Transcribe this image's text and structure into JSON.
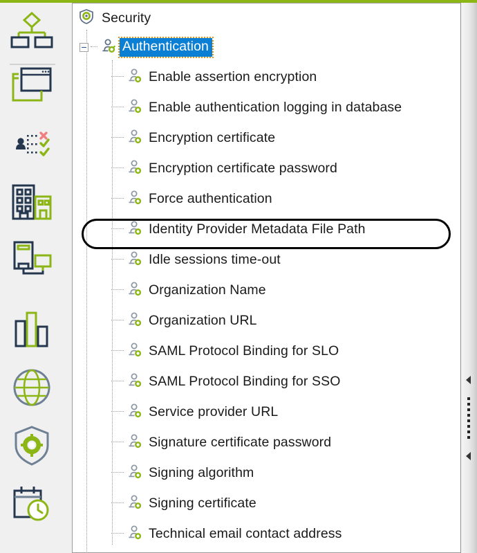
{
  "theme": {
    "accent_green": "#8cb516",
    "dark_navy": "#25374f",
    "selection_blue": "#0a7fd4",
    "focus_orange": "#e8921c",
    "panel_border": "#9a9a9a"
  },
  "sidebar": {
    "items": [
      {
        "icon": "org-chart-icon",
        "name": "sidebar-item-org-chart"
      },
      {
        "icon": "window-layout-icon",
        "name": "sidebar-item-window-layout"
      },
      {
        "icon": "user-provisioning-icon",
        "name": "sidebar-item-user-provisioning"
      },
      {
        "icon": "buildings-icon",
        "name": "sidebar-item-buildings"
      },
      {
        "icon": "devices-icon",
        "name": "sidebar-item-devices"
      },
      {
        "icon": "bar-chart-icon",
        "name": "sidebar-item-bar-chart"
      },
      {
        "icon": "globe-icon",
        "name": "sidebar-item-globe"
      },
      {
        "icon": "shield-gear-icon",
        "name": "sidebar-item-security"
      },
      {
        "icon": "calendar-clock-icon",
        "name": "sidebar-item-calendar-clock"
      }
    ]
  },
  "tree": {
    "root": {
      "label": "Security",
      "icon": "shield-gear-icon"
    },
    "group": {
      "label": "Authentication",
      "icon": "user-key-icon",
      "expanded": true,
      "selected": true
    },
    "children": [
      {
        "label": "Enable assertion encryption",
        "icon": "user-key-icon"
      },
      {
        "label": "Enable authentication logging in database",
        "icon": "user-key-icon"
      },
      {
        "label": "Encryption certificate",
        "icon": "user-key-icon"
      },
      {
        "label": "Encryption certificate password",
        "icon": "user-key-icon"
      },
      {
        "label": "Force authentication",
        "icon": "user-key-icon"
      },
      {
        "label": "Identity Provider Metadata File Path",
        "icon": "user-key-icon",
        "annotated": true
      },
      {
        "label": "Idle sessions time-out",
        "icon": "user-key-icon"
      },
      {
        "label": "Organization Name",
        "icon": "user-key-icon"
      },
      {
        "label": "Organization URL",
        "icon": "user-key-icon"
      },
      {
        "label": "SAML Protocol Binding for SLO",
        "icon": "user-key-icon"
      },
      {
        "label": "SAML Protocol Binding for SSO",
        "icon": "user-key-icon"
      },
      {
        "label": "Service provider URL",
        "icon": "user-key-icon"
      },
      {
        "label": "Signature certificate password",
        "icon": "user-key-icon"
      },
      {
        "label": "Signing algorithm",
        "icon": "user-key-icon"
      },
      {
        "label": "Signing certificate",
        "icon": "user-key-icon"
      },
      {
        "label": "Technical email contact address",
        "icon": "user-key-icon"
      }
    ]
  },
  "splitter": {
    "collapse_icon_top": "collapse-left-arrow-icon",
    "collapse_icon_bottom": "collapse-left-arrow-icon",
    "grip": "splitter-grip-icon"
  }
}
